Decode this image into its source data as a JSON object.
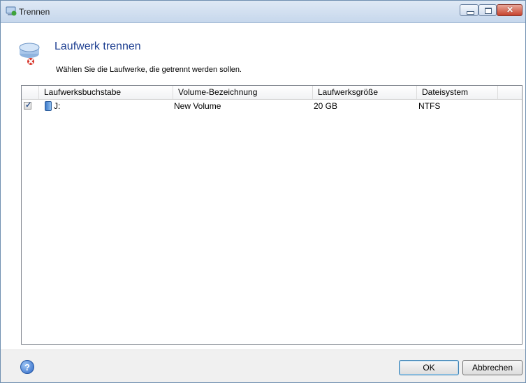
{
  "window": {
    "title": "Trennen"
  },
  "header": {
    "heading": "Laufwerk trennen",
    "subtext": "Wählen Sie die Laufwerke, die getrennt werden sollen."
  },
  "table": {
    "columns": [
      "Laufwerksbuchstabe",
      "Volume-Bezeichnung",
      "Laufwerksgröße",
      "Dateisystem"
    ],
    "rows": [
      {
        "checked": true,
        "letter": "J:",
        "label": "New Volume",
        "size": "20 GB",
        "fs": "NTFS"
      }
    ]
  },
  "footer": {
    "ok_label": "OK",
    "cancel_label": "Abbrechen",
    "help_glyph": "?"
  },
  "icons": {
    "drive": "drive-disconnect-icon",
    "volume": "volume-icon",
    "help": "help-icon"
  },
  "colors": {
    "heading": "#1e3f91",
    "titlebar": "#c6d7ec"
  }
}
